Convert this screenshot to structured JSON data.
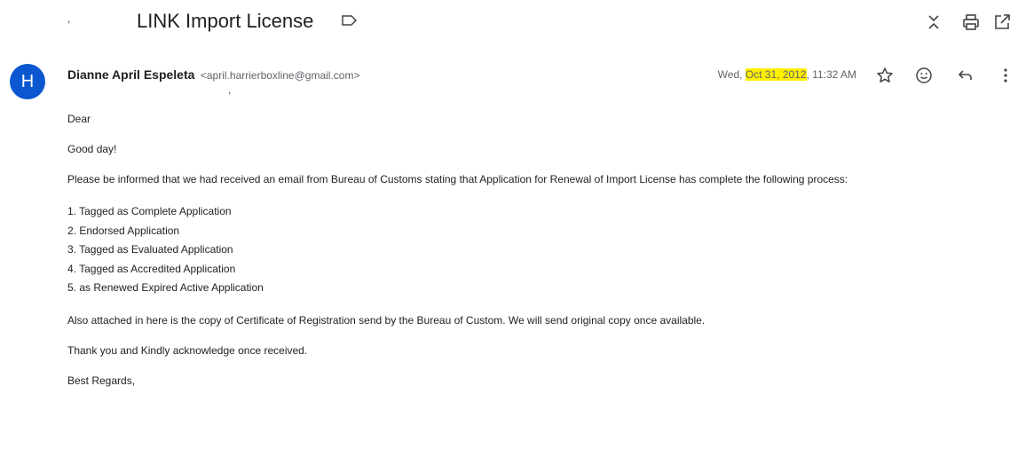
{
  "header": {
    "subject": "LINK Import License",
    "stray_mark": ","
  },
  "icons": {
    "label": "label-outline-icon",
    "expand": "unfold-icon",
    "print": "printer-icon",
    "open_new": "open-in-new-icon",
    "star": "star-outline-icon",
    "emoji": "emoji-smile-icon",
    "reply": "reply-icon",
    "more": "more-vert-icon"
  },
  "message": {
    "avatar_letter": "H",
    "sender_name": "Dianne April Espeleta",
    "sender_email": "<april.harrierboxline@gmail.com>",
    "sender_stray_mark": ",",
    "date_prefix": "Wed, ",
    "date_highlight": "Oct 31, 2012",
    "date_suffix": ", 11:32 AM"
  },
  "body": {
    "greeting": "Dear",
    "goodday": "Good day!",
    "para1": "Please be informed that we had received an email from Bureau of Customs stating that Application for Renewal of Import License has complete the following process:",
    "list": [
      "1. Tagged as Complete Application",
      "2. Endorsed Application",
      "3. Tagged as Evaluated Application",
      "4. Tagged as Accredited Application",
      "5. as Renewed Expired Active Application"
    ],
    "para2": "Also attached in here is the copy of Certificate of Registration send by the Bureau of Custom. We will send original copy once available.",
    "para3": "Thank you and Kindly acknowledge once received.",
    "signoff": "Best Regards,"
  },
  "colors": {
    "avatar_bg": "#0b57d0",
    "highlight": "#fff000"
  }
}
